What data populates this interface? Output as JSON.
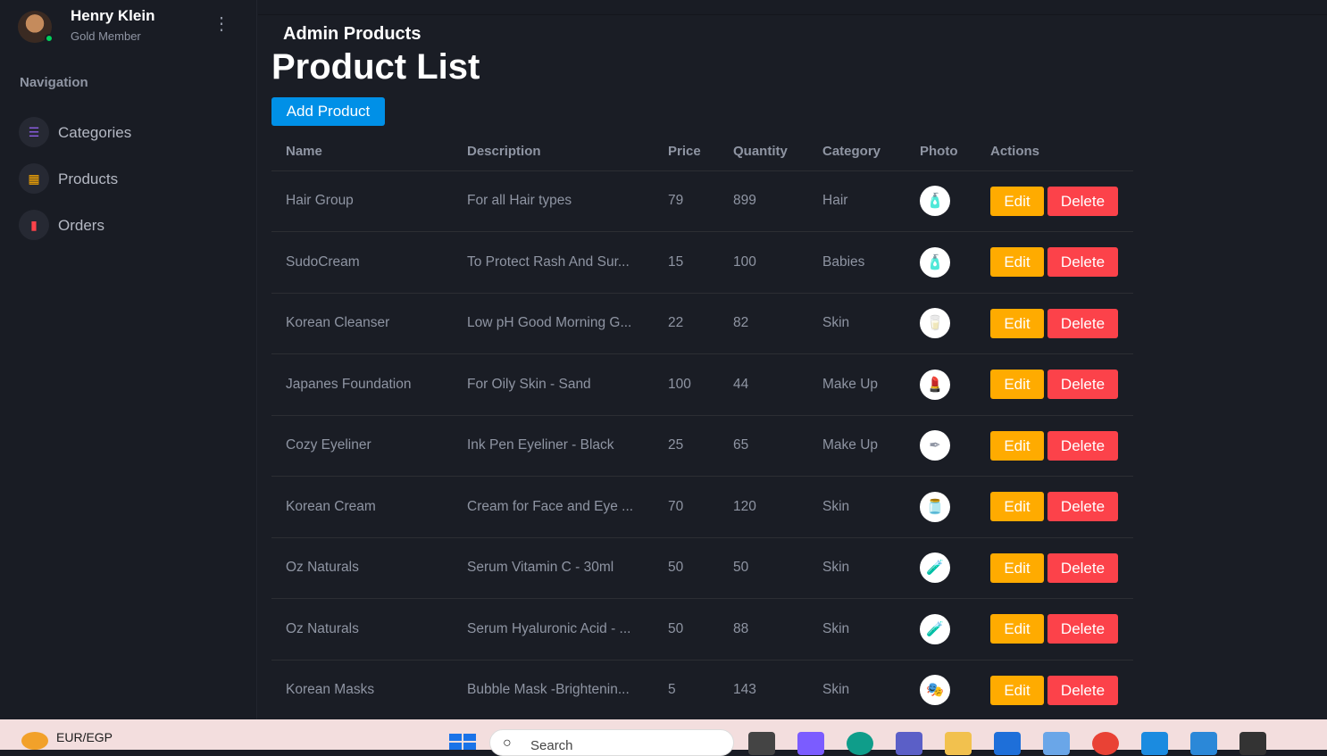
{
  "profile": {
    "name": "Henry Klein",
    "rank": "Gold Member",
    "menu_icon": "kebab-icon"
  },
  "nav": {
    "title": "Navigation",
    "items": [
      {
        "label": "Categories",
        "icon": "list-icon",
        "color": "#8f5fe8"
      },
      {
        "label": "Products",
        "icon": "grid-icon",
        "color": "#ffab00"
      },
      {
        "label": "Orders",
        "icon": "bar-chart-icon",
        "color": "#fc424a"
      }
    ]
  },
  "page": {
    "subtitle": "Admin Products",
    "title": "Product List",
    "add_label": "Add Product"
  },
  "table": {
    "headers": [
      "Name",
      "Description",
      "Price",
      "Quantity",
      "Category",
      "Photo",
      "Actions"
    ],
    "edit_label": "Edit",
    "delete_label": "Delete",
    "rows": [
      {
        "name": "Hair Group",
        "desc": "For all Hair types",
        "price": "79",
        "qty": "899",
        "cat": "Hair"
      },
      {
        "name": "SudoCream",
        "desc": "To Protect Rash And Sur...",
        "price": "15",
        "qty": "100",
        "cat": "Babies"
      },
      {
        "name": "Korean Cleanser",
        "desc": "Low pH Good Morning G...",
        "price": "22",
        "qty": "82",
        "cat": "Skin"
      },
      {
        "name": "Japanes Foundation",
        "desc": "For Oily Skin - Sand",
        "price": "100",
        "qty": "44",
        "cat": "Make Up"
      },
      {
        "name": "Cozy Eyeliner",
        "desc": "Ink Pen Eyeliner - Black",
        "price": "25",
        "qty": "65",
        "cat": "Make Up"
      },
      {
        "name": "Korean Cream",
        "desc": "Cream for Face and Eye ...",
        "price": "70",
        "qty": "120",
        "cat": "Skin"
      },
      {
        "name": "Oz Naturals",
        "desc": "Serum Vitamin C - 30ml",
        "price": "50",
        "qty": "50",
        "cat": "Skin"
      },
      {
        "name": "Oz Naturals",
        "desc": "Serum Hyaluronic Acid - ...",
        "price": "50",
        "qty": "88",
        "cat": "Skin"
      },
      {
        "name": "Korean Masks",
        "desc": "Bubble Mask -Brightenin...",
        "price": "5",
        "qty": "143",
        "cat": "Skin"
      }
    ]
  },
  "taskbar": {
    "currency": "EUR/EGP",
    "search_placeholder": "Search"
  },
  "colors": {
    "accent": "#0090e7",
    "edit": "#ffab00",
    "delete": "#fc424a",
    "online": "#00d25b"
  }
}
